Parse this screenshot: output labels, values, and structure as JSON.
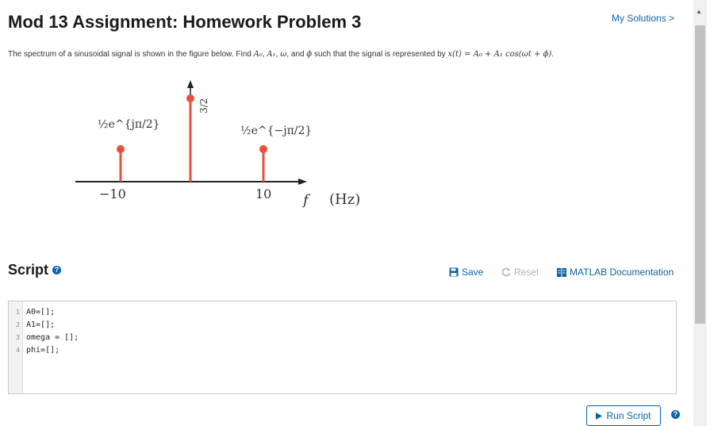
{
  "header": {
    "title": "Mod 13 Assignment: Homework Problem 3",
    "my_solutions": "My Solutions >"
  },
  "problem": {
    "text_before": "The spectrum of a sinusoidal signal is shown in the figure below. Find ",
    "A0": "A₀",
    "comma1": ", ",
    "A1": "A₁",
    "comma2": ", ",
    "omega": "ω",
    "and": ", and ",
    "phi": "ϕ",
    "text_mid": " such that the signal is represented by ",
    "equation": "x(t) = A₀ + A₁ cos(ωt + ϕ)",
    "period": "."
  },
  "figure": {
    "left_label": "½e^{jπ/2}",
    "center_label": "3/2",
    "right_label": "½e^{−jπ/2}",
    "tick_left": "−10",
    "tick_right": "10",
    "axis_var": "f",
    "axis_unit": "(Hz)",
    "stem_color": "#e8503a"
  },
  "script": {
    "heading": "Script",
    "help": "?",
    "save": "Save",
    "reset": "Reset",
    "docs": "MATLAB Documentation",
    "lines": [
      {
        "num": "1",
        "code": "A0=[];"
      },
      {
        "num": "2",
        "code": "A1=[];"
      },
      {
        "num": "3",
        "code": "omega = [];"
      },
      {
        "num": "4",
        "code": "phi=[];"
      }
    ],
    "run": "Run Script"
  }
}
